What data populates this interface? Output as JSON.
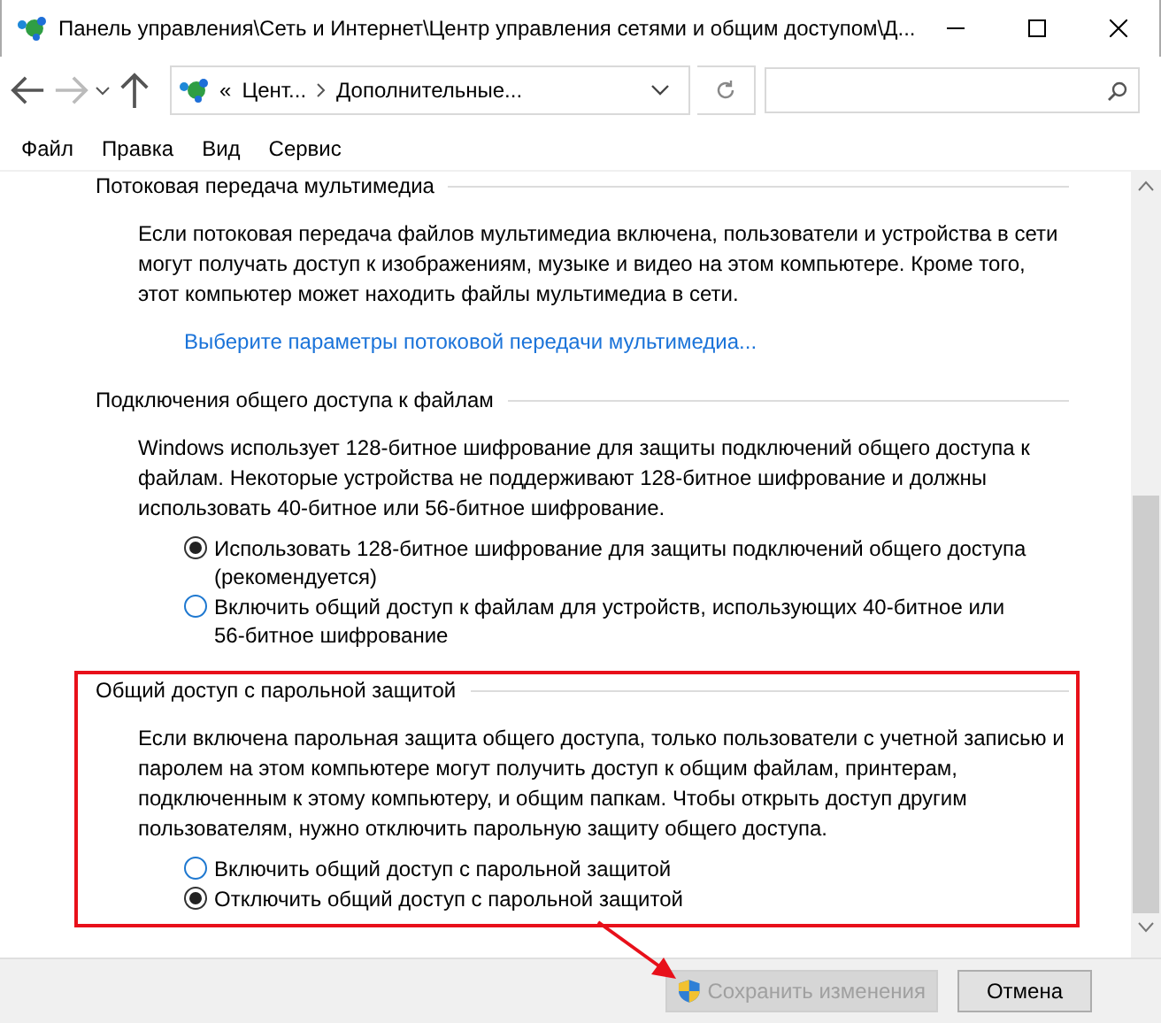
{
  "window": {
    "title": "Панель управления\\Сеть и Интернет\\Центр управления сетями и общим доступом\\Д..."
  },
  "address_bar": {
    "overflow": "«",
    "crumbs": [
      "Цент...",
      "Дополнительные..."
    ]
  },
  "menu": [
    "Файл",
    "Правка",
    "Вид",
    "Сервис"
  ],
  "sections": [
    {
      "heading": "Потоковая передача мультимедиа",
      "highlighted": false,
      "text": "Если потоковая передача файлов мультимедиа включена, пользователи и устройства в сети могут получать доступ к изображениям, музыке и видео на этом компьютере. Кроме того, этот компьютер может находить файлы мультимедиа в сети.",
      "link": "Выберите параметры потоковой передачи мультимедиа..."
    },
    {
      "heading": "Подключения общего доступа к файлам",
      "highlighted": false,
      "text": "Windows использует 128-битное шифрование для защиты подключений общего доступа к файлам. Некоторые устройства не поддерживают 128-битное шифрование и должны использовать 40-битное или 56-битное шифрование.",
      "options": [
        {
          "label": "Использовать 128-битное шифрование для защиты подключений общего доступа (рекомендуется)",
          "selected": true
        },
        {
          "label": "Включить общий доступ к файлам для устройств, использующих 40-битное или 56-битное шифрование",
          "selected": false
        }
      ]
    },
    {
      "heading": "Общий доступ с парольной защитой",
      "highlighted": true,
      "text": "Если включена парольная защита общего доступа, только пользователи с учетной записью и паролем на этом компьютере могут получить доступ к общим файлам, принтерам, подключенным к этому компьютеру, и общим папкам. Чтобы открыть доступ другим пользователям, нужно отключить парольную защиту общего доступа.",
      "options": [
        {
          "label": "Включить общий доступ с парольной защитой",
          "selected": false
        },
        {
          "label": "Отключить общий доступ с парольной защитой",
          "selected": true
        }
      ]
    }
  ],
  "buttons": [
    {
      "label": "Сохранить изменения",
      "kind": "save",
      "disabled": true
    },
    {
      "label": "Отмена",
      "kind": "plain",
      "disabled": false
    }
  ]
}
